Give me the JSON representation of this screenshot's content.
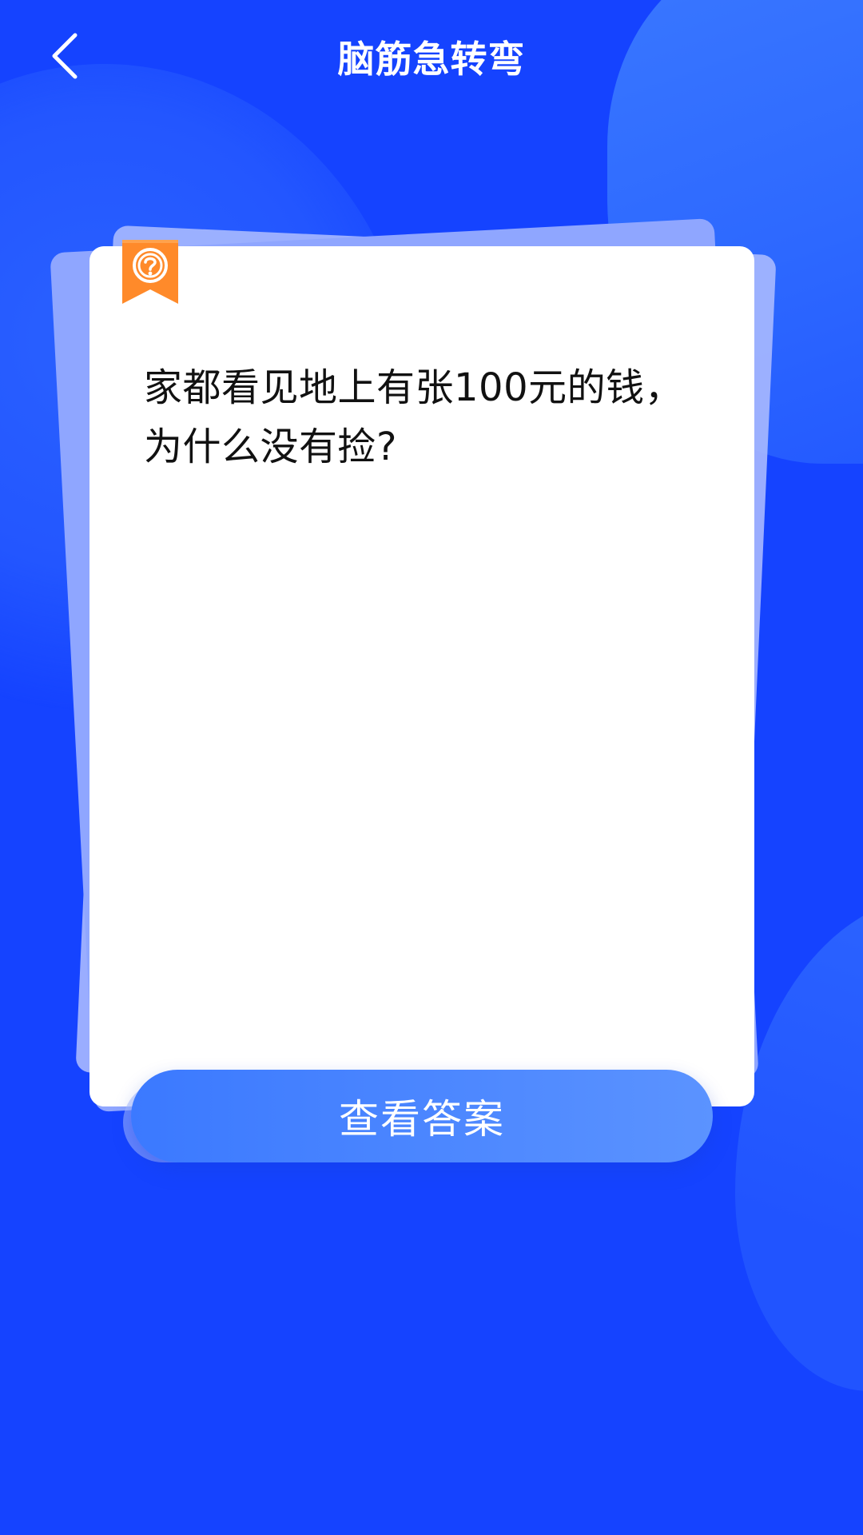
{
  "header": {
    "title": "脑筋急转弯"
  },
  "card": {
    "question": "家都看见地上有张100元的钱，为什么没有捡?"
  },
  "actions": {
    "view_answer_label": "查看答案"
  },
  "icons": {
    "back": "chevron-left-icon",
    "ribbon": "question-ribbon-icon"
  },
  "colors": {
    "background": "#1543ff",
    "ribbon": "#ff8a2a",
    "button": "#4d86ff"
  }
}
